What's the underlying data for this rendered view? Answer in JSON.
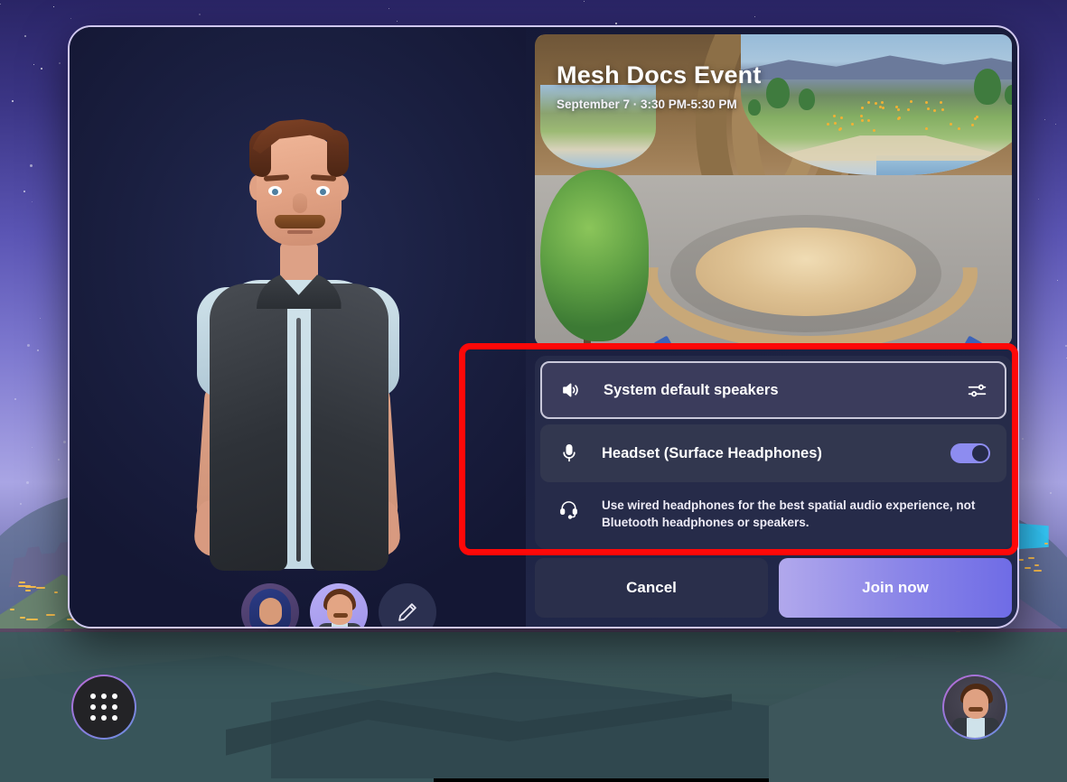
{
  "event": {
    "title": "Mesh Docs Event",
    "datetime": "September 7 · 3:30 PM-5:30 PM"
  },
  "avatar_picker": {
    "thumb1_name": "avatar-option-1",
    "thumb2_name": "avatar-option-2",
    "edit_label": "pencil-icon"
  },
  "audio": {
    "speaker": {
      "label": "System default speakers",
      "icon": "speaker-icon",
      "settings_icon": "audio-settings-icon",
      "selected": true
    },
    "mic": {
      "label": "Headset (Surface Headphones)",
      "icon": "microphone-icon",
      "toggle_on": true
    },
    "hint": {
      "icon": "headset-icon",
      "text": "Use wired headphones for the best spatial audio experience, not Bluetooth headphones or speakers."
    }
  },
  "actions": {
    "cancel": "Cancel",
    "join": "Join now"
  },
  "taskbar": {
    "apps_icon": "apps-grid-icon",
    "profile_icon": "user-avatar-icon"
  },
  "colors": {
    "accent": "#8b86e8",
    "annotation": "#fd0808",
    "panel": "#262b49",
    "dialog_bg": "#1a1e3d"
  }
}
